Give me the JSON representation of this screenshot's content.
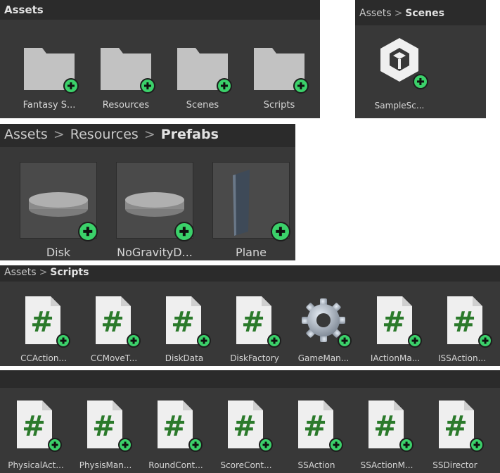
{
  "assets_panel": {
    "title": "Assets",
    "items": [
      "Fantasy S...",
      "Resources",
      "Scenes",
      "Scripts"
    ]
  },
  "scenes_panel": {
    "breadcrumb_root": "Assets",
    "breadcrumb_sep": ">",
    "breadcrumb_current": "Scenes",
    "items": [
      "SampleSc..."
    ]
  },
  "prefabs_panel": {
    "breadcrumb_root": "Assets",
    "breadcrumb_sep": ">",
    "breadcrumb_mid": "Resources",
    "breadcrumb_current": "Prefabs",
    "items": [
      "Disk",
      "NoGravityD...",
      "Plane"
    ]
  },
  "scripts_panel": {
    "breadcrumb_root": "Assets",
    "breadcrumb_sep": ">",
    "breadcrumb_current": "Scripts",
    "row1": [
      "CCAction...",
      "CCMoveT...",
      "DiskData",
      "DiskFactory",
      "GameMan...",
      "IActionMa...",
      "ISSAction..."
    ],
    "row2": [
      "PhysicalAct...",
      "PhysisMan...",
      "RoundCont...",
      "ScoreCont...",
      "SSAction",
      "SSActionM...",
      "SSDirector"
    ]
  },
  "icons": {
    "folder": "folder-icon",
    "scene": "unity-scene-icon",
    "script": "csharp-script-icon",
    "settings": "gear-icon",
    "add_badge": "plus-badge-icon"
  },
  "colors": {
    "panel_bg": "#383838",
    "header_bg": "#2b2b2b",
    "badge_green": "#3bd16a",
    "script_hash": "#2b7a2b",
    "folder": "#c2c2c2"
  }
}
